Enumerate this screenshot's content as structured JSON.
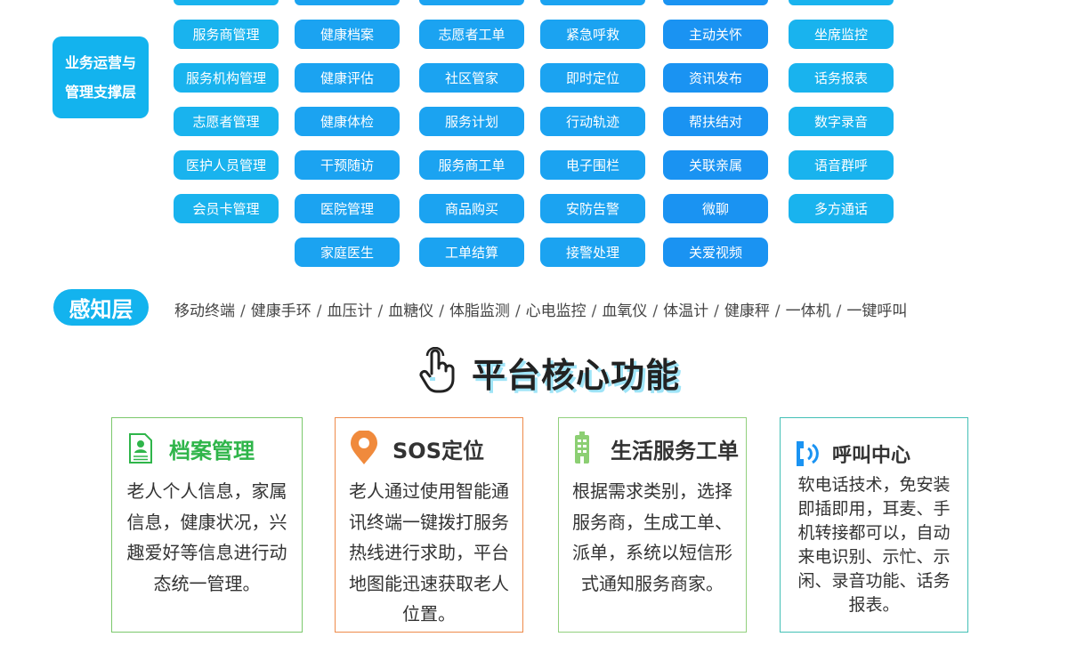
{
  "business_layer": {
    "label": "业务运营与\n管理支撑层",
    "columns": [
      [
        "服务商管理",
        "服务机构管理",
        "志愿者管理",
        "医护人员管理",
        "会员卡管理"
      ],
      [
        "健康档案",
        "健康评估",
        "健康体检",
        "干预随访",
        "医院管理",
        "家庭医生"
      ],
      [
        "志愿者工单",
        "社区管家",
        "服务计划",
        "服务商工单",
        "商品购买",
        "工单结算"
      ],
      [
        "紧急呼救",
        "即时定位",
        "行动轨迹",
        "电子围栏",
        "安防告警",
        "接警处理"
      ],
      [
        "主动关怀",
        "资讯发布",
        "帮扶结对",
        "关联亲属",
        "微聊",
        "关爱视频"
      ],
      [
        "坐席监控",
        "话务报表",
        "数字录音",
        "语音群呼",
        "多方通话"
      ]
    ]
  },
  "perception_layer": {
    "label": "感知层",
    "devices": [
      "移动终端",
      "健康手环",
      "血压计",
      "血糖仪",
      "体脂监测",
      "心电监控",
      "血氧仪",
      "体温计",
      "健康秤",
      "一体机",
      "一键呼叫"
    ],
    "separator": "/"
  },
  "core": {
    "title": "平台核心功能",
    "icon": "pointing-hand-icon"
  },
  "cards": [
    {
      "title": "档案管理",
      "icon": "profile-document-icon",
      "lines": [
        "老人个人信息，家属",
        "信息，健康状况，兴",
        "趣爱好等信息进行动",
        "态统一管理。"
      ]
    },
    {
      "title": "SOS定位",
      "icon": "location-pin-icon",
      "lines": [
        "老人通过使用智能通",
        "讯终端一键拨打服务",
        "热线进行求助，平台",
        "地图能迅速获取老人",
        "位置。"
      ]
    },
    {
      "title": "生活服务工单",
      "icon": "building-icon",
      "lines": [
        "根据需求类别，选择",
        "服务商，生成工单、",
        "派单，系统以短信形",
        "式通知服务商家。"
      ]
    },
    {
      "title": "呼叫中心",
      "icon": "call-center-icon",
      "lines": [
        "软电话技术，免安装",
        "即插即用，耳麦、手",
        "机转接都可以，自动",
        "来电识别、示忙、示",
        "闲、录音功能、话务",
        "报表。"
      ]
    }
  ],
  "colors": {
    "accent": "#13b3ee",
    "card_borders": [
      "#7bc86b",
      "#ee8a4a",
      "#91d07d",
      "#43c0b6"
    ],
    "archive_title": "#2fb54a"
  }
}
